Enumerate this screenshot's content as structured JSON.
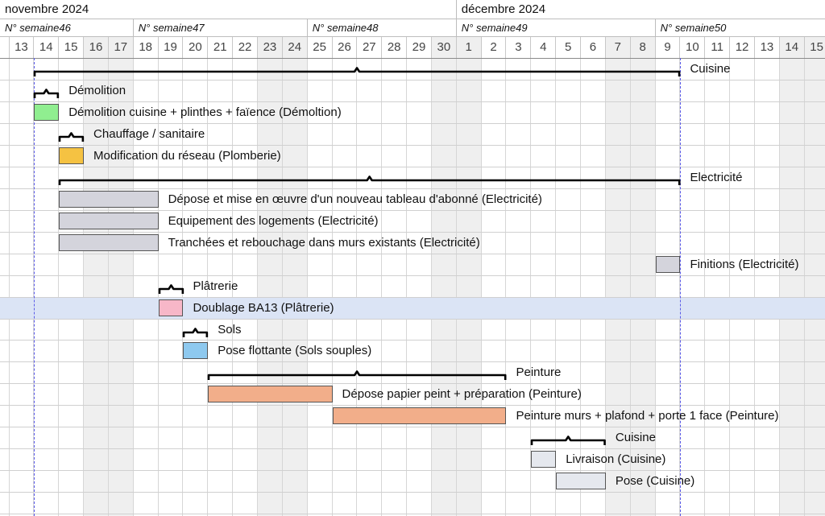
{
  "months": [
    {
      "label": "novembre 2024",
      "first_day_index": 0,
      "day_count": 18
    },
    {
      "label": "décembre 2024",
      "first_day_index": 18,
      "day_count": 15
    }
  ],
  "weeks": [
    {
      "label": "N° semaine46",
      "first_day_index": 0,
      "day_count": 5
    },
    {
      "label": "N° semaine47",
      "first_day_index": 5,
      "day_count": 7
    },
    {
      "label": "N° semaine48",
      "first_day_index": 12,
      "day_count": 6
    },
    {
      "label": "N° semaine49",
      "first_day_index": 18,
      "day_count": 8
    },
    {
      "label": "N° semaine50",
      "first_day_index": 26,
      "day_count": 7
    }
  ],
  "days": [
    "13",
    "14",
    "15",
    "16",
    "17",
    "18",
    "19",
    "20",
    "21",
    "22",
    "23",
    "24",
    "25",
    "26",
    "27",
    "28",
    "29",
    "30",
    "1",
    "2",
    "3",
    "4",
    "5",
    "6",
    "7",
    "8",
    "9",
    "10",
    "11",
    "12",
    "13",
    "14",
    "15"
  ],
  "weekend_days": [
    3,
    4,
    10,
    11,
    17,
    18,
    24,
    25,
    31,
    32
  ],
  "highlighted_row": 11,
  "project_markers": [
    1,
    27
  ],
  "colors": {
    "demolition": "#90ee90",
    "plomberie": "#f5c242",
    "electricite": "#d4d4dc",
    "platrerie": "#f7b7c8",
    "sols": "#8ec9ef",
    "peinture": "#f2ae8a",
    "cuisine": "#e5e8ee",
    "highlight_row": "#dbe4f5",
    "marker_line": "#5a5ae8"
  },
  "tasks": [
    {
      "row": 0,
      "type": "summary",
      "start": 1,
      "end": 27,
      "label": "Cuisine"
    },
    {
      "row": 1,
      "type": "summary",
      "start": 1,
      "end": 2,
      "label": "Démolition"
    },
    {
      "row": 2,
      "type": "task",
      "start": 1,
      "end": 2,
      "label": "Démolition cuisine + plinthes + faïence (Démoltion)",
      "color": "demolition"
    },
    {
      "row": 3,
      "type": "summary",
      "start": 2,
      "end": 3,
      "label": "Chauffage / sanitaire"
    },
    {
      "row": 4,
      "type": "task",
      "start": 2,
      "end": 3,
      "label": "Modification du réseau (Plomberie)",
      "color": "plomberie"
    },
    {
      "row": 5,
      "type": "summary",
      "start": 2,
      "end": 27,
      "label": "Electricité"
    },
    {
      "row": 6,
      "type": "task",
      "start": 2,
      "end": 6,
      "label": "Dépose et mise en œuvre d'un nouveau tableau d'abonné (Electricité)",
      "color": "electricite"
    },
    {
      "row": 7,
      "type": "task",
      "start": 2,
      "end": 6,
      "label": "Equipement des logements (Electricité)",
      "color": "electricite"
    },
    {
      "row": 8,
      "type": "task",
      "start": 2,
      "end": 6,
      "label": "Tranchées et rebouchage dans murs existants (Electricité)",
      "color": "electricite"
    },
    {
      "row": 9,
      "type": "task",
      "start": 26,
      "end": 27,
      "label": "Finitions (Electricité)",
      "color": "electricite"
    },
    {
      "row": 10,
      "type": "summary",
      "start": 6,
      "end": 7,
      "label": "Plâtrerie"
    },
    {
      "row": 11,
      "type": "task",
      "start": 6,
      "end": 7,
      "label": "Doublage BA13 (Plâtrerie)",
      "color": "platrerie"
    },
    {
      "row": 12,
      "type": "summary",
      "start": 7,
      "end": 8,
      "label": "Sols"
    },
    {
      "row": 13,
      "type": "task",
      "start": 7,
      "end": 8,
      "label": "Pose flottante (Sols souples)",
      "color": "sols"
    },
    {
      "row": 14,
      "type": "summary",
      "start": 8,
      "end": 20,
      "label": "Peinture"
    },
    {
      "row": 15,
      "type": "task",
      "start": 8,
      "end": 13,
      "label": "Dépose papier peint + préparation (Peinture)",
      "color": "peinture"
    },
    {
      "row": 16,
      "type": "task",
      "start": 13,
      "end": 20,
      "label": "Peinture murs + plafond + porte 1 face (Peinture)",
      "color": "peinture"
    },
    {
      "row": 17,
      "type": "summary",
      "start": 21,
      "end": 24,
      "label": "Cuisine"
    },
    {
      "row": 18,
      "type": "task",
      "start": 21,
      "end": 22,
      "label": "Livraison (Cuisine)",
      "color": "cuisine"
    },
    {
      "row": 19,
      "type": "task",
      "start": 22,
      "end": 24,
      "label": "Pose (Cuisine)",
      "color": "cuisine"
    }
  ]
}
